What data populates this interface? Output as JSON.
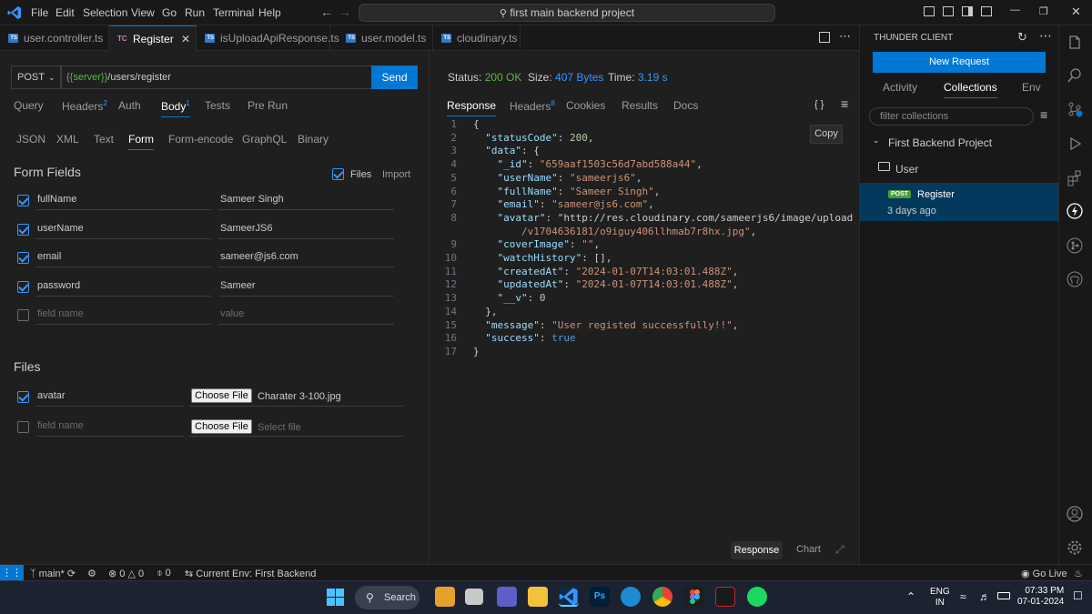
{
  "menu": [
    "File",
    "Edit",
    "Selection",
    "View",
    "Go",
    "Run",
    "Terminal",
    "Help"
  ],
  "command_center": "first main backend project",
  "tabs": [
    {
      "label": "user.controller.ts"
    },
    {
      "label": "Register",
      "active": true
    },
    {
      "label": "isUploadApiResponse.ts"
    },
    {
      "label": "user.model.ts"
    },
    {
      "label": "cloudinary.ts"
    }
  ],
  "tab_badge_tc": "TC",
  "request": {
    "method": "POST",
    "url_var": "{{server}}",
    "url_path": "/users/register",
    "send_label": "Send"
  },
  "request_tabs": {
    "query": "Query",
    "headers": "Headers",
    "headers_count": "2",
    "auth": "Auth",
    "body": "Body",
    "body_count": "1",
    "tests": "Tests",
    "pre_run": "Pre Run"
  },
  "body_tabs": [
    "JSON",
    "XML",
    "Text",
    "Form",
    "Form-encode",
    "GraphQL",
    "Binary"
  ],
  "form": {
    "title": "Form Fields",
    "files_toggle": "Files",
    "import": "Import",
    "fields": [
      {
        "name": "fullName",
        "value": "Sameer Singh",
        "checked": true
      },
      {
        "name": "userName",
        "value": "SameerJS6",
        "checked": true
      },
      {
        "name": "email",
        "value": "sameer@js6.com",
        "checked": true
      },
      {
        "name": "password",
        "value": "Sameer",
        "checked": true
      }
    ],
    "name_placeholder": "field name",
    "value_placeholder": "value"
  },
  "files": {
    "title": "Files",
    "choose_label": "Choose File",
    "rows": [
      {
        "name": "avatar",
        "file": "Charater 3-100.jpg",
        "checked": true
      }
    ],
    "name_placeholder": "field name",
    "select_placeholder": "Select file"
  },
  "response": {
    "status_label": "Status:",
    "status": "200 OK",
    "size_label": "Size:",
    "size": "407 Bytes",
    "time_label": "Time:",
    "time": "3.19 s",
    "tabs": {
      "response": "Response",
      "headers": "Headers",
      "headers_count": "8",
      "cookies": "Cookies",
      "results": "Results",
      "docs": "Docs"
    },
    "braces_icon": "{ }",
    "copy": "Copy",
    "bottom_response": "Response",
    "bottom_chart": "Chart"
  },
  "code_lines": [
    "{",
    "  \"statusCode\": 200,",
    "  \"data\": {",
    "    \"_id\": \"659aaf1503c56d7abd588a44\",",
    "    \"userName\": \"sameerjs6\",",
    "    \"fullName\": \"Sameer Singh\",",
    "    \"email\": \"sameer@js6.com\",",
    "    \"avatar\": \"http://res.cloudinary.com/sameerjs6/image/upload",
    "        /v1704636181/o9iguy406llhmab7r8hx.jpg\",",
    "    \"coverImage\": \"\",",
    "    \"watchHistory\": [],",
    "    \"createdAt\": \"2024-01-07T14:03:01.488Z\",",
    "    \"updatedAt\": \"2024-01-07T14:03:01.488Z\",",
    "    \"__v\": 0",
    "  },",
    "  \"message\": \"User registed successfully!!\",",
    "  \"success\": true",
    "}"
  ],
  "line_numbers": [
    "1",
    "2",
    "3",
    "4",
    "5",
    "6",
    "7",
    "",
    "9",
    "10",
    "11",
    "12",
    "13",
    "14",
    "15",
    "16",
    "17"
  ],
  "thunder": {
    "title": "THUNDER CLIENT",
    "new_request": "New Request",
    "tabs": {
      "activity": "Activity",
      "collections": "Collections",
      "env": "Env"
    },
    "filter_placeholder": "filter collections",
    "project": "First Backend Project",
    "folder": "User",
    "request_method": "POST",
    "request_name": "Register",
    "request_time": "3 days ago"
  },
  "statusbar": {
    "branch": "main*",
    "errors": "0",
    "warnings": "0",
    "ports": "0",
    "env": "Current Env: First Backend",
    "golive": "Go Live"
  },
  "taskbar": {
    "search": "Search",
    "lang": "ENG",
    "region": "IN",
    "time": "07:33 PM",
    "date": "07-01-2024"
  },
  "colors": {
    "accent": "#0078d4",
    "success": "#5fb347",
    "link": "#3794ff",
    "bg": "#1f1f1f",
    "panel": "#181818"
  }
}
